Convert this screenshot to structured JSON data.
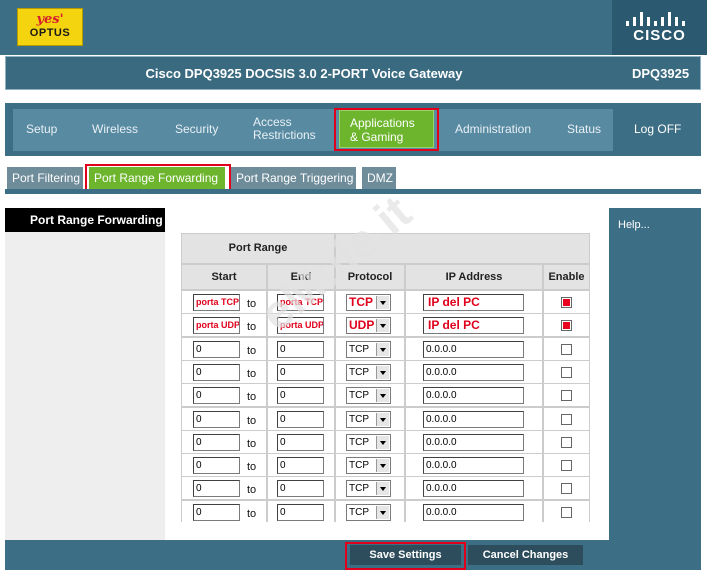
{
  "brand": {
    "logo_line1": "yes'",
    "logo_line2": "OPTUS",
    "vendor_logo": "CISCO"
  },
  "header": {
    "product": "Cisco DPQ3925 DOCSIS 3.0 2-PORT Voice Gateway",
    "model": "DPQ3925"
  },
  "nav": {
    "setup": "Setup",
    "wireless": "Wireless",
    "security": "Security",
    "access_l1": "Access",
    "access_l2": "Restrictions",
    "apps_l1": "Applications",
    "apps_l2": "& Gaming",
    "administration": "Administration",
    "status": "Status",
    "logoff": "Log OFF"
  },
  "tabs": {
    "port_filtering": "Port Filtering",
    "port_range_forwarding": "Port Range Forwarding",
    "port_range_triggering": "Port Range Triggering",
    "dmz": "DMZ"
  },
  "sidebar": {
    "section_title": "Port Range Forwarding",
    "help": "Help..."
  },
  "table": {
    "group_header": "Port Range",
    "col_start": "Start",
    "col_end": "End",
    "col_protocol": "Protocol",
    "col_ip": "IP Address",
    "col_enable": "Enable",
    "to_label": "to",
    "rows": [
      {
        "start": "porta TCP",
        "end": "porta TCP",
        "protocol": "TCP",
        "ip": "IP del PC",
        "enabled": true
      },
      {
        "start": "porta UDP",
        "end": "porta UDP",
        "protocol": "UDP",
        "ip": "IP del PC",
        "enabled": true
      },
      {
        "start": "0",
        "end": "0",
        "protocol": "TCP",
        "ip": "0.0.0.0",
        "enabled": false
      },
      {
        "start": "0",
        "end": "0",
        "protocol": "TCP",
        "ip": "0.0.0.0",
        "enabled": false
      },
      {
        "start": "0",
        "end": "0",
        "protocol": "TCP",
        "ip": "0.0.0.0",
        "enabled": false
      },
      {
        "start": "0",
        "end": "0",
        "protocol": "TCP",
        "ip": "0.0.0.0",
        "enabled": false
      },
      {
        "start": "0",
        "end": "0",
        "protocol": "TCP",
        "ip": "0.0.0.0",
        "enabled": false
      },
      {
        "start": "0",
        "end": "0",
        "protocol": "TCP",
        "ip": "0.0.0.0",
        "enabled": false
      },
      {
        "start": "0",
        "end": "0",
        "protocol": "TCP",
        "ip": "0.0.0.0",
        "enabled": false
      },
      {
        "start": "0",
        "end": "0",
        "protocol": "TCP",
        "ip": "0.0.0.0",
        "enabled": false
      }
    ]
  },
  "buttons": {
    "save": "Save Settings",
    "cancel": "Cancel Changes"
  },
  "watermark": "eMule.it",
  "colors": {
    "header_blue": "#3c6e85",
    "active_green": "#6cb52c",
    "highlight_red": "#e0001b"
  }
}
